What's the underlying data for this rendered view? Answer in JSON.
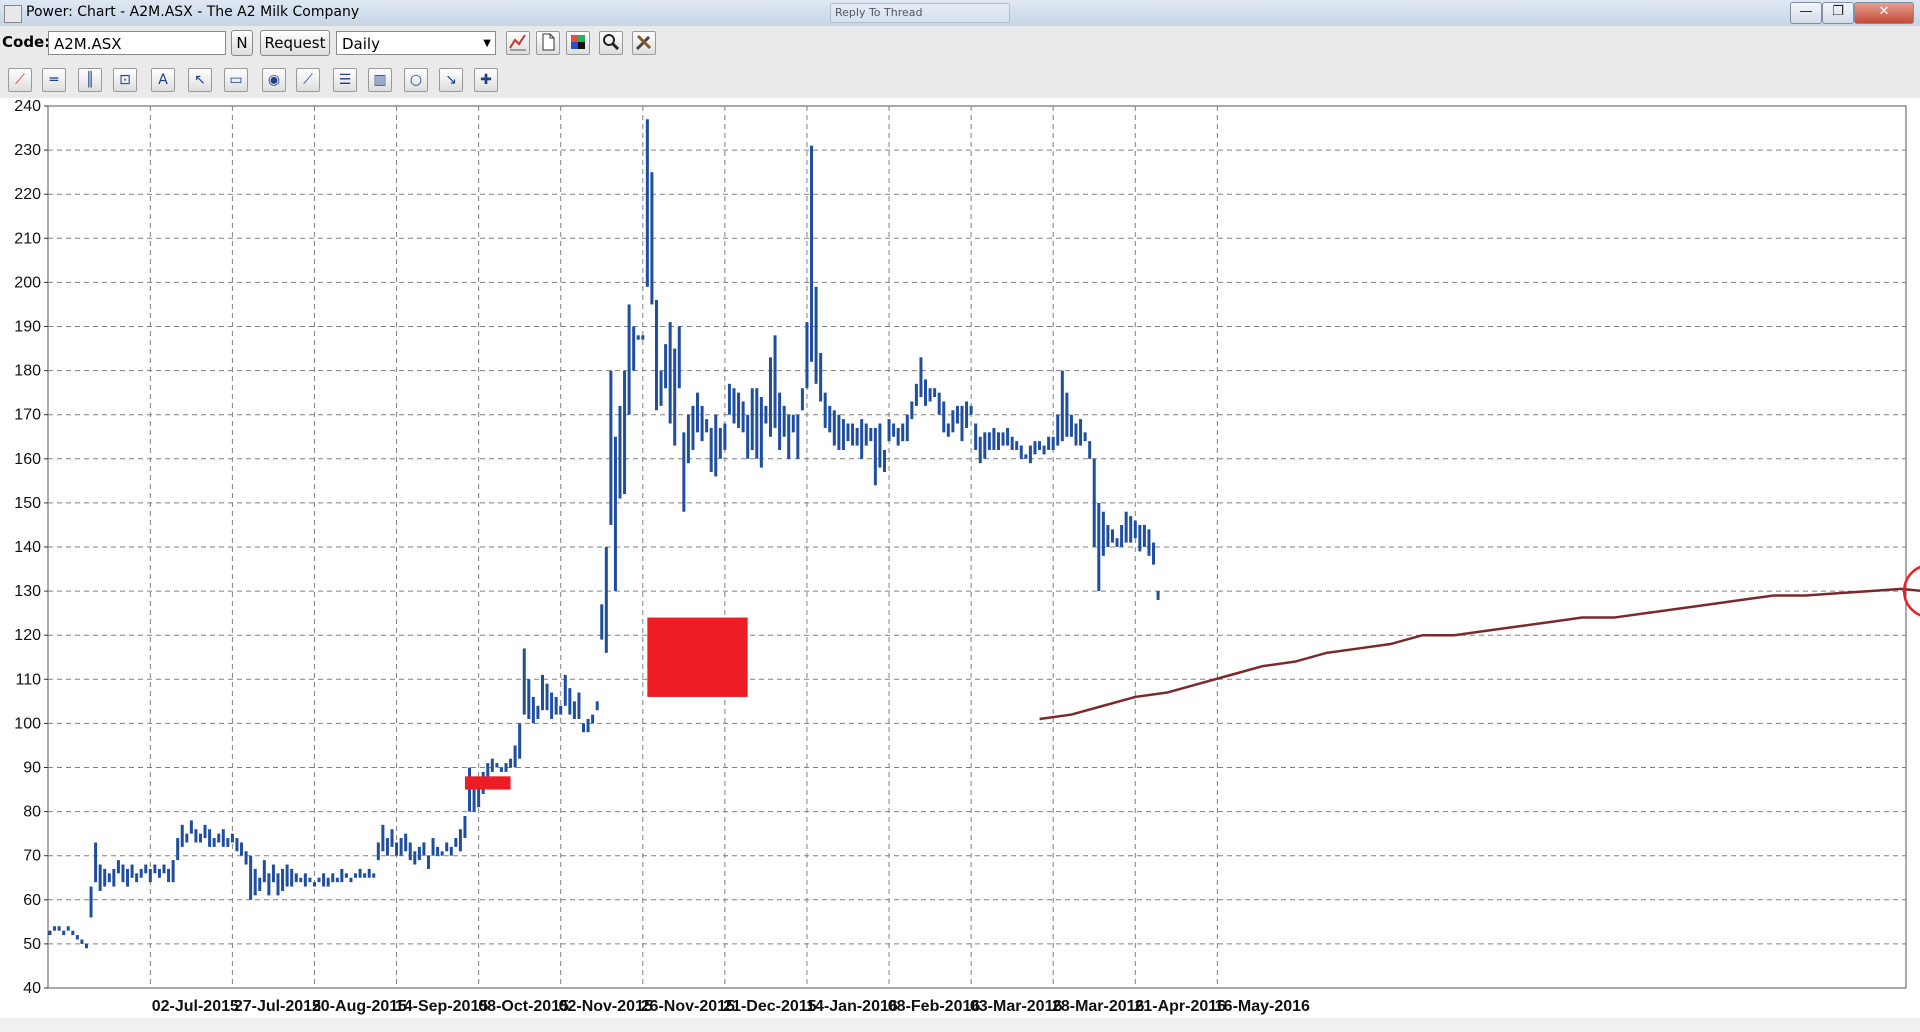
{
  "window": {
    "title": "Power: Chart - A2M.ASX - The A2 Milk Company",
    "background_tab": "Reply To Thread",
    "controls": [
      "—",
      "❐",
      "✕"
    ]
  },
  "toolbar": {
    "code_label": "Code:",
    "code_value": "A2M.ASX",
    "n_button": "N",
    "request_button": "Request",
    "period_value": "Daily",
    "period_arrow": "▼",
    "icons": [
      "chart-type-icon",
      "new-page-icon",
      "color-palette-icon",
      "zoom-icon",
      "tools-icon"
    ]
  },
  "drawing_tools": [
    {
      "name": "trend-line-icon",
      "glyph": "⟋"
    },
    {
      "name": "horizontal-line-icon",
      "glyph": "═"
    },
    {
      "name": "vertical-line-icon",
      "glyph": "║"
    },
    {
      "name": "box-select-icon",
      "glyph": "⊡"
    },
    {
      "name": "text-tool-icon",
      "glyph": "A"
    },
    {
      "name": "pointer-icon",
      "glyph": "↖"
    },
    {
      "name": "rectangle-icon",
      "glyph": "▭"
    },
    {
      "name": "ellipse-fill-icon",
      "glyph": "◉"
    },
    {
      "name": "fibonacci-fan-icon",
      "glyph": "⟋"
    },
    {
      "name": "fibonacci-retracement-icon",
      "glyph": "☰"
    },
    {
      "name": "fibonacci-timezones-icon",
      "glyph": "▥"
    },
    {
      "name": "circle-icon",
      "glyph": "○"
    },
    {
      "name": "arrow-icon",
      "glyph": "↘"
    },
    {
      "name": "crosshair-icon",
      "glyph": "✚"
    }
  ],
  "colors": {
    "bars": "#1f4e9e",
    "moving_average": "#7a2a2a",
    "annotation_red": "#ee1c25",
    "grid": "#808080"
  },
  "chart_data": {
    "type": "ohlc-bar",
    "title": "",
    "xlabel": "",
    "ylabel": "",
    "ylim": [
      40,
      240
    ],
    "yticks": [
      40,
      50,
      60,
      70,
      80,
      90,
      100,
      110,
      120,
      130,
      140,
      150,
      160,
      170,
      180,
      190,
      200,
      210,
      220,
      230,
      240
    ],
    "xlabels": [
      "02-Jul-2015",
      "27-Jul-2015",
      "20-Aug-2015",
      "14-Sep-2015",
      "08-Oct-2015",
      "02-Nov-2015",
      "26-Nov-2015",
      "21-Dec-2015",
      "14-Jan-2016",
      "08-Feb-2016",
      "03-Mar-2016",
      "28-Mar-2016",
      "21-Apr-2016",
      "16-May-2016"
    ],
    "grid": true,
    "series": [
      {
        "name": "",
        "points": [
          [
            53,
            52
          ],
          [
            54,
            53
          ],
          [
            54,
            53
          ],
          [
            53,
            52
          ],
          [
            54,
            53
          ],
          [
            53,
            52
          ],
          [
            52,
            51
          ],
          [
            51,
            50
          ],
          [
            50,
            49
          ],
          [
            63,
            56
          ],
          [
            73,
            64
          ],
          [
            68,
            62
          ],
          [
            67,
            63
          ],
          [
            66,
            64
          ],
          [
            67,
            63
          ],
          [
            69,
            66
          ],
          [
            68,
            64
          ],
          [
            67,
            63
          ],
          [
            68,
            65
          ],
          [
            66,
            64
          ],
          [
            67,
            65
          ],
          [
            68,
            66
          ],
          [
            67,
            64
          ],
          [
            68,
            66
          ],
          [
            67,
            65
          ],
          [
            68,
            66
          ],
          [
            67,
            64
          ],
          [
            69,
            64
          ],
          [
            74,
            69
          ],
          [
            77,
            72
          ],
          [
            75,
            73
          ],
          [
            78,
            75
          ],
          [
            76,
            73
          ],
          [
            75,
            73
          ],
          [
            77,
            74
          ],
          [
            76,
            72
          ],
          [
            74,
            72
          ],
          [
            75,
            73
          ],
          [
            76,
            72
          ],
          [
            74,
            72
          ],
          [
            75,
            73
          ],
          [
            74,
            71
          ],
          [
            73,
            70
          ],
          [
            71,
            68
          ],
          [
            70,
            60
          ],
          [
            67,
            61
          ],
          [
            65,
            62
          ],
          [
            69,
            64
          ],
          [
            66,
            61
          ],
          [
            68,
            64
          ],
          [
            66,
            61
          ],
          [
            67,
            62
          ],
          [
            68,
            63
          ],
          [
            67,
            63
          ],
          [
            66,
            64
          ],
          [
            65,
            64
          ],
          [
            66,
            63
          ],
          [
            65,
            64
          ],
          [
            64,
            63
          ],
          [
            65,
            64
          ],
          [
            66,
            63
          ],
          [
            65,
            63
          ],
          [
            66,
            64
          ],
          [
            65,
            64
          ],
          [
            67,
            64
          ],
          [
            66,
            65
          ],
          [
            65,
            64
          ],
          [
            66,
            65
          ],
          [
            67,
            65
          ],
          [
            66,
            65
          ],
          [
            67,
            65
          ],
          [
            66,
            65
          ],
          [
            73,
            69
          ],
          [
            77,
            71
          ],
          [
            74,
            70
          ],
          [
            76,
            72
          ],
          [
            73,
            70
          ],
          [
            74,
            70
          ],
          [
            75,
            71
          ],
          [
            73,
            69
          ],
          [
            71,
            68
          ],
          [
            72,
            69
          ],
          [
            73,
            70
          ],
          [
            70,
            67
          ],
          [
            74,
            70
          ],
          [
            72,
            70
          ],
          [
            71,
            70
          ],
          [
            73,
            71
          ],
          [
            72,
            70
          ],
          [
            74,
            72
          ],
          [
            76,
            71
          ],
          [
            79,
            74
          ],
          [
            90,
            80
          ],
          [
            85,
            80
          ],
          [
            86,
            81
          ],
          [
            89,
            84
          ],
          [
            91,
            87
          ],
          [
            92,
            89
          ],
          [
            91,
            90
          ],
          [
            90,
            89
          ],
          [
            91,
            89
          ],
          [
            92,
            90
          ],
          [
            95,
            90
          ],
          [
            100,
            92
          ],
          [
            117,
            102
          ],
          [
            110,
            101
          ],
          [
            106,
            100
          ],
          [
            104,
            101
          ],
          [
            111,
            103
          ],
          [
            109,
            103
          ],
          [
            107,
            101
          ],
          [
            106,
            102
          ],
          [
            104,
            102
          ],
          [
            111,
            104
          ],
          [
            108,
            102
          ],
          [
            105,
            101
          ],
          [
            107,
            101
          ],
          [
            100,
            98
          ],
          [
            101,
            98
          ],
          [
            102,
            100
          ],
          [
            105,
            103
          ],
          [
            127,
            119
          ],
          [
            140,
            116
          ],
          [
            180,
            145
          ],
          [
            165,
            130
          ],
          [
            172,
            151
          ],
          [
            180,
            152
          ],
          [
            195,
            170
          ],
          [
            190,
            180
          ],
          [
            188,
            187
          ],
          [
            188,
            187
          ],
          [
            237,
            199
          ],
          [
            225,
            195
          ],
          [
            196,
            171
          ],
          [
            180,
            172
          ],
          [
            186,
            176
          ],
          [
            191,
            168
          ],
          [
            185,
            163
          ],
          [
            190,
            176
          ],
          [
            166,
            148
          ],
          [
            170,
            159
          ],
          [
            172,
            162
          ],
          [
            175,
            166
          ],
          [
            172,
            164
          ],
          [
            169,
            166
          ],
          [
            167,
            157
          ],
          [
            170,
            156
          ],
          [
            167,
            160
          ],
          [
            168,
            162
          ],
          [
            177,
            170
          ],
          [
            176,
            168
          ],
          [
            175,
            167
          ],
          [
            173,
            166
          ],
          [
            170,
            160
          ],
          [
            176,
            162
          ],
          [
            176,
            160
          ],
          [
            174,
            158
          ],
          [
            172,
            168
          ],
          [
            183,
            165
          ],
          [
            188,
            167
          ],
          [
            175,
            162
          ],
          [
            172,
            165
          ],
          [
            170,
            160
          ],
          [
            170,
            166
          ],
          [
            170,
            160
          ],
          [
            176,
            171
          ],
          [
            191,
            176
          ],
          [
            231,
            182
          ],
          [
            199,
            177
          ],
          [
            184,
            173
          ],
          [
            175,
            167
          ],
          [
            172,
            166
          ],
          [
            171,
            163
          ],
          [
            170,
            162
          ],
          [
            169,
            162
          ],
          [
            168,
            164
          ],
          [
            168,
            163
          ],
          [
            167,
            163
          ],
          [
            169,
            160
          ],
          [
            168,
            163
          ],
          [
            167,
            164
          ],
          [
            167,
            154
          ],
          [
            168,
            158
          ],
          [
            162,
            157
          ],
          [
            169,
            164
          ],
          [
            168,
            165
          ],
          [
            167,
            163
          ],
          [
            168,
            164
          ],
          [
            170,
            164
          ],
          [
            173,
            169
          ],
          [
            177,
            172
          ],
          [
            183,
            174
          ],
          [
            178,
            172
          ],
          [
            176,
            173
          ],
          [
            176,
            174
          ],
          [
            175,
            170
          ],
          [
            173,
            166
          ],
          [
            168,
            165
          ],
          [
            171,
            166
          ],
          [
            172,
            168
          ],
          [
            172,
            164
          ],
          [
            173,
            167
          ],
          [
            172,
            170
          ],
          [
            168,
            162
          ],
          [
            165,
            159
          ],
          [
            166,
            160
          ],
          [
            166,
            162
          ],
          [
            167,
            162
          ],
          [
            166,
            162
          ],
          [
            166,
            163
          ],
          [
            167,
            163
          ],
          [
            165,
            162
          ],
          [
            164,
            162
          ],
          [
            163,
            160
          ],
          [
            161,
            160
          ],
          [
            163,
            159
          ],
          [
            164,
            161
          ],
          [
            164,
            162
          ],
          [
            163,
            161
          ],
          [
            165,
            162
          ],
          [
            165,
            162
          ],
          [
            170,
            163
          ],
          [
            180,
            164
          ],
          [
            175,
            165
          ],
          [
            170,
            165
          ],
          [
            168,
            163
          ],
          [
            169,
            163
          ],
          [
            166,
            164
          ],
          [
            164,
            160
          ],
          [
            160,
            140
          ],
          [
            150,
            130
          ],
          [
            148,
            138
          ],
          [
            145,
            140
          ],
          [
            144,
            141
          ],
          [
            142,
            140
          ],
          [
            145,
            140
          ],
          [
            148,
            141
          ],
          [
            147,
            141
          ],
          [
            146,
            142
          ],
          [
            145,
            139
          ],
          [
            145,
            140
          ],
          [
            144,
            138
          ],
          [
            141,
            136
          ],
          [
            130,
            128
          ]
        ]
      },
      {
        "name": "",
        "type": "line",
        "points": [
          [
            217,
            101
          ],
          [
            224,
            102
          ],
          [
            231,
            104
          ],
          [
            238,
            106
          ],
          [
            245,
            107
          ],
          [
            252,
            109
          ],
          [
            259,
            111
          ],
          [
            266,
            113
          ],
          [
            273,
            114
          ],
          [
            280,
            116
          ],
          [
            287,
            117
          ],
          [
            294,
            118
          ],
          [
            301,
            120
          ],
          [
            308,
            120
          ],
          [
            315,
            121
          ],
          [
            322,
            122
          ],
          [
            329,
            123
          ],
          [
            336,
            124
          ],
          [
            343,
            124
          ],
          [
            350,
            125
          ],
          [
            357,
            126
          ],
          [
            364,
            127
          ],
          [
            371,
            128
          ],
          [
            378,
            129
          ],
          [
            385,
            129
          ],
          [
            392,
            129.5
          ],
          [
            399,
            130
          ],
          [
            406,
            130.5
          ],
          [
            411,
            130
          ]
        ]
      }
    ],
    "annotations": [
      {
        "type": "rectangle",
        "color": "#ee1c25",
        "x": [
          91,
          101
        ],
        "y": [
          85,
          88
        ]
      },
      {
        "type": "rectangle",
        "color": "#ee1c25",
        "x": [
          131,
          153
        ],
        "y": [
          106,
          124
        ]
      },
      {
        "type": "circle",
        "color": "#ee1c25",
        "x": 411,
        "y": 130
      }
    ]
  }
}
